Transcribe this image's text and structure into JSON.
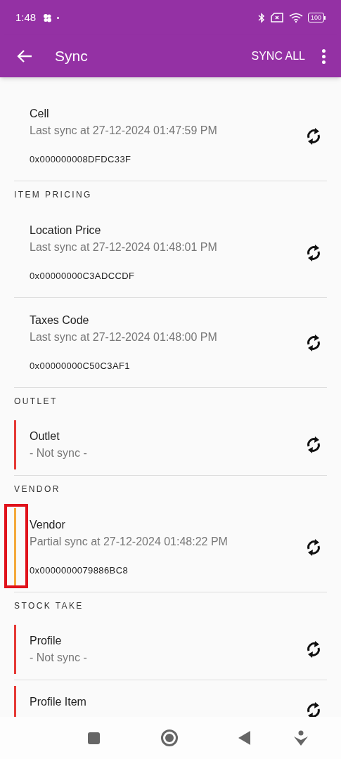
{
  "status_bar": {
    "time": "1:48",
    "battery": "100"
  },
  "app_bar": {
    "title": "Sync",
    "action": "SYNC ALL"
  },
  "sections": [
    {
      "items": [
        {
          "title": "Cell",
          "subtitle": "Last sync at 27-12-2024 01:47:59 PM",
          "hash": "0x000000008DFDC33F",
          "highlighted": false
        }
      ]
    },
    {
      "header": "ITEM PRICING",
      "items": [
        {
          "title": "Location Price",
          "subtitle": "Last sync at 27-12-2024 01:48:01 PM",
          "hash": "0x00000000C3ADCCDF",
          "highlighted": false
        },
        {
          "title": "Taxes Code",
          "subtitle": "Last sync at 27-12-2024 01:48:00 PM",
          "hash": "0x00000000C50C3AF1",
          "highlighted": false
        }
      ]
    },
    {
      "header": "OUTLET",
      "items": [
        {
          "title": "Outlet",
          "subtitle": "- Not sync -",
          "color": "#e53935",
          "highlighted": false
        }
      ]
    },
    {
      "header": "VENDOR",
      "items": [
        {
          "title": "Vendor",
          "subtitle": "Partial sync at 27-12-2024 01:48:22 PM",
          "hash": "0x0000000079886BC8",
          "color": "#f4a93b",
          "highlighted": true
        }
      ]
    },
    {
      "header": "STOCK TAKE",
      "items": [
        {
          "title": "Profile",
          "subtitle": "- Not sync -",
          "color": "#e53935",
          "highlighted": false
        },
        {
          "title": "Profile Item",
          "color": "#e53935",
          "highlighted": false
        }
      ]
    }
  ]
}
